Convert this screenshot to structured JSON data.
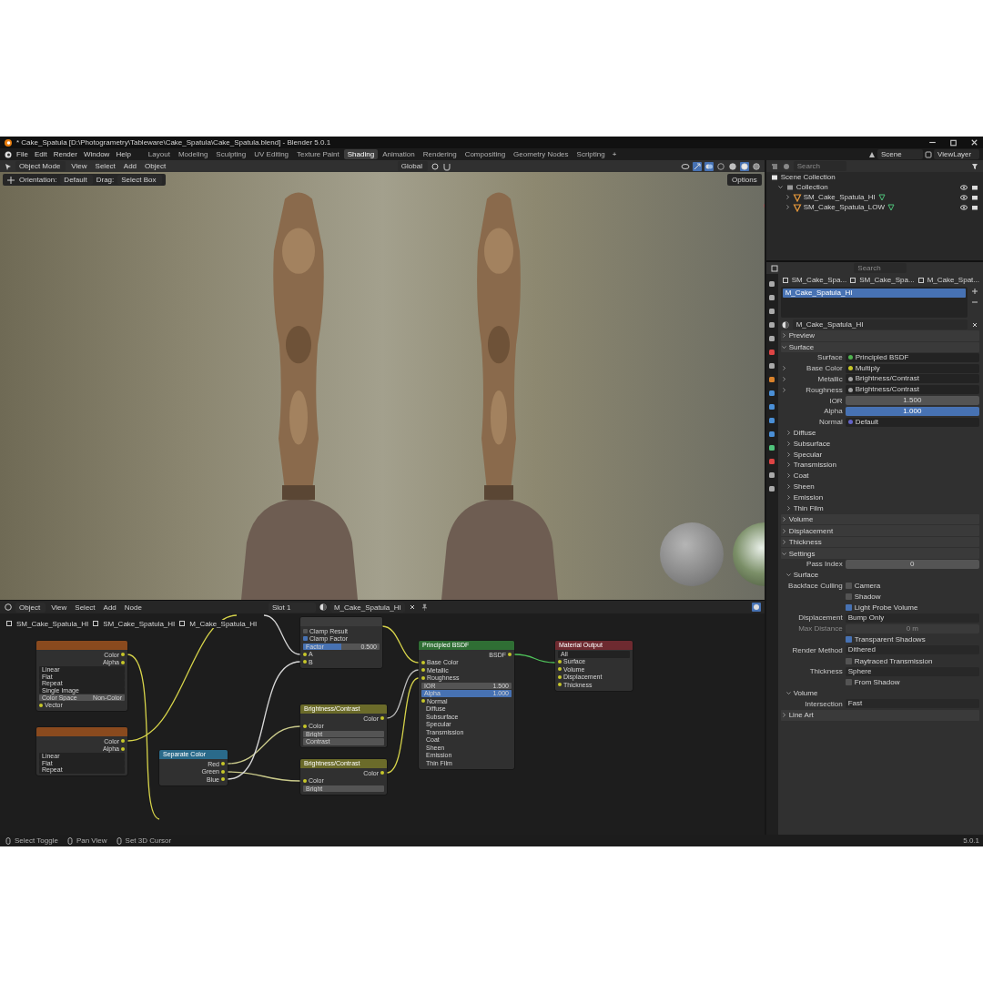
{
  "window": {
    "title": "* Cake_Spatula [D:\\Photogrametry\\Tableware\\Cake_Spatula\\Cake_Spatula.blend] - Blender 5.0.1"
  },
  "menu": [
    "File",
    "Edit",
    "Render",
    "Window",
    "Help"
  ],
  "workspaces": [
    {
      "label": "Layout",
      "selected": false
    },
    {
      "label": "Modeling",
      "selected": false
    },
    {
      "label": "Sculpting",
      "selected": false
    },
    {
      "label": "UV Editing",
      "selected": false
    },
    {
      "label": "Texture Paint",
      "selected": false
    },
    {
      "label": "Shading",
      "selected": true
    },
    {
      "label": "Animation",
      "selected": false
    },
    {
      "label": "Rendering",
      "selected": false
    },
    {
      "label": "Compositing",
      "selected": false
    },
    {
      "label": "Geometry Nodes",
      "selected": false
    },
    {
      "label": "Scripting",
      "selected": false
    }
  ],
  "add_workspace": "+",
  "scene": "Scene",
  "view_layer": "ViewLayer",
  "viewport": {
    "mode": "Object Mode",
    "menu": [
      "View",
      "Select",
      "Add",
      "Object"
    ],
    "orientation": "Global",
    "options": "Options",
    "shading_modes": [
      {
        "kind": "wireframe",
        "selected": false
      },
      {
        "kind": "solid",
        "selected": false
      },
      {
        "kind": "material",
        "selected": true
      },
      {
        "kind": "rendered",
        "selected": false
      }
    ],
    "tool_settings": {
      "orientation_label": "Orientation:",
      "orientation": "Default",
      "drag_label": "Drag:",
      "drag": "Select Box"
    }
  },
  "node_editor": {
    "mode": "Object",
    "menu": [
      "View",
      "Select",
      "Add",
      "Node"
    ],
    "slot": "Slot 1",
    "material": "M_Cake_Spatula_HI",
    "breadcrumbs": [
      "SM_Cake_Spatula_HI",
      "SM_Cake_Spatula_HI",
      "M_Cake_Spatula_HI"
    ],
    "nodes": [
      {
        "color": "#8a4a1e",
        "rows": [
          {
            "kind": "output",
            "text": "Color"
          },
          {
            "kind": "output",
            "text": "Alpha"
          },
          {
            "kind": "dropdown",
            "text": "Linear"
          },
          {
            "kind": "dropdown",
            "text": "Flat"
          },
          {
            "kind": "dropdown",
            "text": "Repeat"
          },
          {
            "kind": "dropdown",
            "text": "Single Image"
          },
          {
            "kind": "field",
            "text": "Color Space",
            "value": "Non-Color"
          },
          {
            "kind": "input",
            "text": "Vector"
          }
        ]
      },
      {
        "color": "#8a4a1e",
        "rows": [
          {
            "kind": "output",
            "text": "Color"
          },
          {
            "kind": "output",
            "text": "Alpha"
          },
          {
            "kind": "dropdown",
            "text": "Linear"
          },
          {
            "kind": "dropdown",
            "text": "Flat"
          },
          {
            "kind": "dropdown",
            "text": "Repeat"
          }
        ]
      },
      {
        "title": "Separate Color",
        "color": "#2a6a8a",
        "rows": [
          {
            "kind": "output",
            "text": "Red"
          },
          {
            "kind": "output",
            "text": "Green"
          },
          {
            "kind": "output",
            "text": "Blue"
          }
        ]
      },
      {
        "color": "#3c3c3c",
        "rows": [
          {
            "kind": "checkbox",
            "text": "Clamp Result",
            "checked": false
          },
          {
            "kind": "checkbox",
            "text": "Clamp Factor",
            "checked": true
          },
          {
            "kind": "slider",
            "text": "Factor",
            "value": "0.500",
            "level": 0.5
          },
          {
            "kind": "input",
            "text": "A"
          },
          {
            "kind": "input",
            "text": "B"
          }
        ]
      },
      {
        "title": "Brightness/Contrast",
        "color": "#6b6b2a",
        "rows": [
          {
            "kind": "output",
            "text": "Color"
          },
          {
            "kind": "input",
            "text": "Color"
          },
          {
            "kind": "field",
            "text": "Bright"
          },
          {
            "kind": "field",
            "text": "Contrast"
          }
        ]
      },
      {
        "title": "Brightness/Contrast",
        "color": "#6b6b2a",
        "rows": [
          {
            "kind": "output",
            "text": "Color"
          },
          {
            "kind": "input",
            "text": "Color"
          },
          {
            "kind": "field",
            "text": "Bright"
          }
        ]
      },
      {
        "title": "Principled BSDF",
        "color": "#2f6e34",
        "rows": [
          {
            "kind": "output",
            "text": "BSDF"
          },
          {
            "kind": "input",
            "text": "Base Color"
          },
          {
            "kind": "input",
            "text": "Metallic"
          },
          {
            "kind": "input",
            "text": "Roughness"
          },
          {
            "kind": "field",
            "text": "IOR",
            "value": "1.500"
          },
          {
            "kind": "slider",
            "text": "Alpha",
            "value": "1.000",
            "level": 1
          },
          {
            "kind": "input",
            "text": "Normal"
          },
          {
            "kind": "panel",
            "text": "Diffuse"
          },
          {
            "kind": "panel",
            "text": "Subsurface"
          },
          {
            "kind": "panel",
            "text": "Specular"
          },
          {
            "kind": "panel",
            "text": "Transmission"
          },
          {
            "kind": "panel",
            "text": "Coat"
          },
          {
            "kind": "panel",
            "text": "Sheen"
          },
          {
            "kind": "panel",
            "text": "Emission"
          },
          {
            "kind": "panel",
            "text": "Thin Film"
          }
        ]
      },
      {
        "title": "Material Output",
        "color": "#6e2a30",
        "rows": [
          {
            "kind": "dropdown",
            "text": "All"
          },
          {
            "kind": "input",
            "text": "Surface"
          },
          {
            "kind": "input",
            "text": "Volume"
          },
          {
            "kind": "input",
            "text": "Displacement"
          },
          {
            "kind": "input",
            "text": "Thickness"
          }
        ]
      }
    ]
  },
  "outliner": {
    "search_placeholder": "Search",
    "tree": [
      {
        "label": "Scene Collection",
        "kind": "scene",
        "children": [
          {
            "label": "Collection",
            "kind": "collection",
            "expanded": true,
            "children": [
              {
                "label": "SM_Cake_Spatula_HI",
                "kind": "object",
                "expanded": false
              },
              {
                "label": "SM_Cake_Spatula_LOW",
                "kind": "object",
                "expanded": false
              }
            ]
          }
        ]
      }
    ]
  },
  "properties": {
    "search_placeholder": "Search",
    "breadcrumbs": [
      "SM_Cake_Spa...",
      "SM_Cake_Spa...",
      "M_Cake_Spat..."
    ],
    "slots": [
      {
        "label": "M_Cake_Spatula_HI",
        "selected": true
      }
    ],
    "material": "M_Cake_Spatula_HI",
    "sections": [
      {
        "title": "Preview",
        "expanded": false
      },
      {
        "title": "Surface",
        "expanded": true,
        "rows": [
          {
            "kind": "socket",
            "label": "Surface",
            "value": "Principled BSDF",
            "expandable": false,
            "color": "#4fb34f"
          },
          {
            "kind": "socket",
            "label": "Base Color",
            "value": "Multiply",
            "expandable": true,
            "color": "#c7c729"
          },
          {
            "kind": "socket",
            "label": "Metallic",
            "value": "Brightness/Contrast",
            "expandable": true,
            "color": "#a1a1a1"
          },
          {
            "kind": "socket",
            "label": "Roughness",
            "value": "Brightness/Contrast",
            "expandable": true,
            "color": "#a1a1a1"
          },
          {
            "kind": "number",
            "label": "IOR",
            "value": "1.500",
            "disabled": false
          },
          {
            "kind": "slider",
            "label": "Alpha",
            "value": "1.000",
            "level": 1
          },
          {
            "kind": "socket",
            "label": "Normal",
            "value": "Default",
            "expandable": false,
            "color": "#6363c7"
          },
          {
            "kind": "subpanel",
            "label": "Diffuse",
            "expanded": false
          },
          {
            "kind": "subpanel",
            "label": "Subsurface",
            "expanded": false
          },
          {
            "kind": "subpanel",
            "label": "Specular",
            "expanded": false
          },
          {
            "kind": "subpanel",
            "label": "Transmission",
            "expanded": false
          },
          {
            "kind": "subpanel",
            "label": "Coat",
            "expanded": false
          },
          {
            "kind": "subpanel",
            "label": "Sheen",
            "expanded": false
          },
          {
            "kind": "subpanel",
            "label": "Emission",
            "expanded": false
          },
          {
            "kind": "subpanel",
            "label": "Thin Film",
            "expanded": false
          }
        ]
      },
      {
        "title": "Volume",
        "expanded": false
      },
      {
        "title": "Displacement",
        "expanded": false
      },
      {
        "title": "Thickness",
        "expanded": false
      },
      {
        "title": "Settings",
        "expanded": true,
        "rows": [
          {
            "kind": "number",
            "label": "Pass Index",
            "value": "0",
            "disabled": false
          },
          {
            "kind": "subpanel",
            "label": "Surface",
            "expanded": true,
            "rows": [
              {
                "kind": "checkbox",
                "label": "Backface Culling",
                "text": "Camera",
                "checked": false
              },
              {
                "kind": "checkbox",
                "text": "Shadow",
                "checked": false
              },
              {
                "kind": "checkbox",
                "text": "Light Probe Volume",
                "checked": true
              },
              {
                "kind": "dropdown",
                "label": "Displacement",
                "value": "Bump Only"
              },
              {
                "kind": "number",
                "label": "Max Distance",
                "value": "0 m",
                "disabled": true
              },
              {
                "kind": "checkbox",
                "text": "Transparent Shadows",
                "checked": true
              },
              {
                "kind": "dropdown",
                "label": "Render Method",
                "value": "Dithered"
              },
              {
                "kind": "checkbox",
                "text": "Raytraced Transmission",
                "checked": false
              },
              {
                "kind": "dropdown",
                "label": "Thickness",
                "value": "Sphere"
              },
              {
                "kind": "checkbox",
                "text": "From Shadow",
                "checked": false
              }
            ]
          },
          {
            "kind": "subpanel",
            "label": "Volume",
            "expanded": true,
            "rows": [
              {
                "kind": "dropdown",
                "label": "Intersection",
                "value": "Fast"
              }
            ]
          }
        ]
      },
      {
        "title": "Line Art",
        "expanded": false
      }
    ]
  },
  "status_bar": {
    "hints": [
      "Select Toggle",
      "Pan View",
      "Set 3D Cursor"
    ],
    "version": "5.0.1"
  }
}
